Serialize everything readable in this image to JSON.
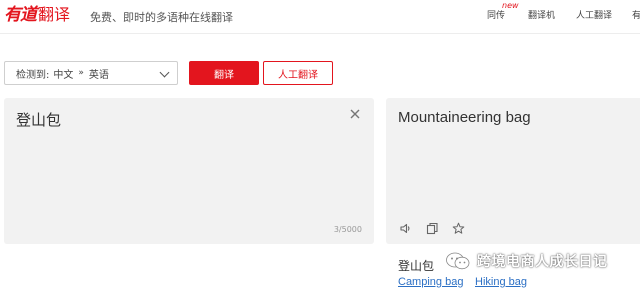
{
  "header": {
    "logo_brand": "有道",
    "logo_product": "翻译",
    "slogan": "免费、即时的多语种在线翻译",
    "nav": {
      "tongchuan": "同传",
      "tongchuan_badge": "new",
      "fanyiji": "翻译机",
      "rengong": "人工翻译",
      "more": "有"
    }
  },
  "toolbar": {
    "lang_detected_label": "检测到:",
    "lang_from": "中文",
    "lang_arrow": "»",
    "lang_to": "英语",
    "translate_button": "翻译",
    "human_translate_button": "人工翻译"
  },
  "input": {
    "text": "登山包",
    "char_count": "3/5000"
  },
  "output": {
    "text": "Mountaineering bag"
  },
  "dictionary": {
    "word": "登山包",
    "related": [
      "Camping bag",
      "Hiking bag"
    ]
  },
  "watermark": {
    "text": "跨境电商人成长日记"
  },
  "colors": {
    "brand_red": "#e3151e",
    "panel_bg": "#f2f2f2",
    "link_blue": "#2b6fc4"
  },
  "icons": {
    "clear": "close-icon",
    "speaker": "speaker-icon",
    "copy": "copy-icon",
    "favorite": "star-icon",
    "select": "chevron-down-icon"
  }
}
